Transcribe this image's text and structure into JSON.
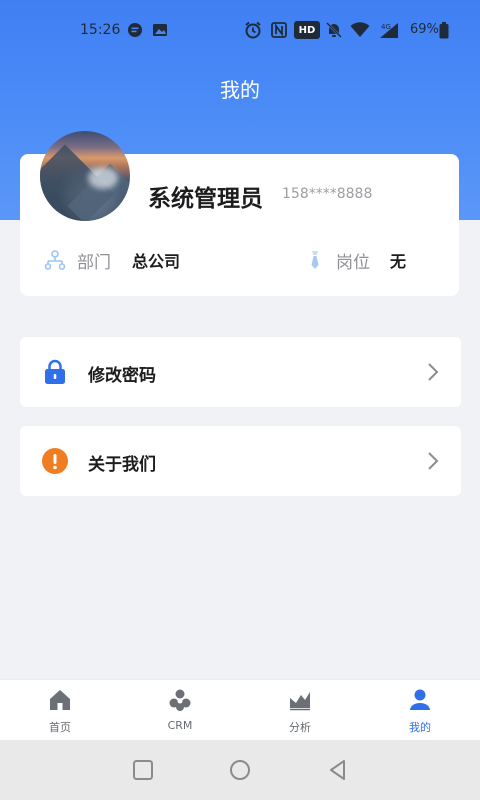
{
  "status_bar": {
    "time": "15:26",
    "hd_badge": "HD",
    "battery": "69%",
    "signal_label": "4G"
  },
  "header": {
    "title": "我的"
  },
  "profile": {
    "name": "系统管理员",
    "phone": "158****8888",
    "department_label": "部门",
    "department_value": "总公司",
    "position_label": "岗位",
    "position_value": "无"
  },
  "menu": {
    "items": [
      {
        "label": "修改密码",
        "icon": "lock-icon"
      },
      {
        "label": "关于我们",
        "icon": "info-alert-icon"
      }
    ]
  },
  "tabs": [
    {
      "label": "首页",
      "icon": "home-icon"
    },
    {
      "label": "CRM",
      "icon": "crm-icon"
    },
    {
      "label": "分析",
      "icon": "chart-icon"
    },
    {
      "label": "我的",
      "icon": "user-icon",
      "active": true
    }
  ],
  "colors": {
    "header_blue": "#3f7ff3",
    "accent": "#2f6fe9",
    "lock_blue": "#2f6fe9",
    "info_orange": "#f07d22"
  }
}
